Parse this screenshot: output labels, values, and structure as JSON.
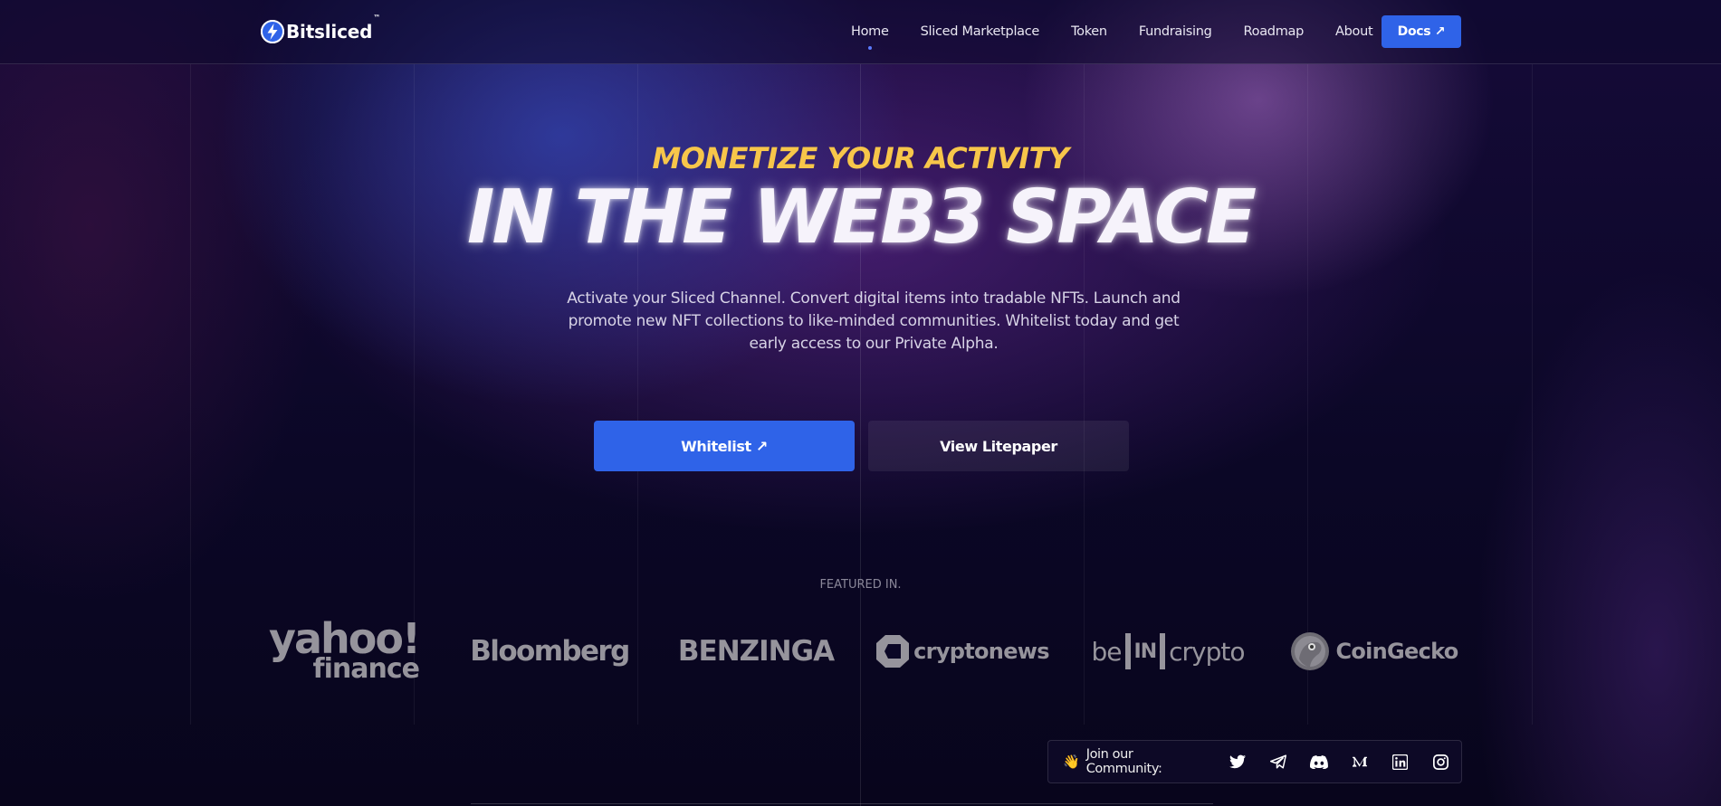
{
  "header": {
    "brand": "Bitsliced",
    "brand_tm": "™",
    "nav": [
      {
        "label": "Home",
        "active": true
      },
      {
        "label": "Sliced Marketplace",
        "active": false
      },
      {
        "label": "Token",
        "active": false
      },
      {
        "label": "Fundraising",
        "active": false
      },
      {
        "label": "Roadmap",
        "active": false
      },
      {
        "label": "About",
        "active": false
      }
    ],
    "docs_button": "Docs ↗"
  },
  "hero": {
    "subtitle": "MONETIZE YOUR ACTIVITY",
    "title": "IN THE WEB3 SPACE",
    "description": "Activate your Sliced Channel. Convert digital items into tradable NFTs. Launch and promote new NFT collections to like-minded communities. Whitelist today and get early access to our Private Alpha.",
    "primary_button": "Whitelist ↗",
    "secondary_button": "View Litepaper"
  },
  "featured": {
    "label": "FEATURED IN.",
    "logos": {
      "yahoo_top": "yahoo!",
      "yahoo_bottom": "finance",
      "bloomberg": "Bloomberg",
      "benzinga": "BENZINGA",
      "cryptonews": "cryptonews",
      "bein_be": "be",
      "bein_in": "IN",
      "bein_crypto": "crypto",
      "coingecko": "CoinGecko"
    }
  },
  "community": {
    "label": "Join our Community:",
    "icons": [
      "twitter-icon",
      "telegram-icon",
      "discord-icon",
      "medium-icon",
      "linkedin-icon",
      "instagram-icon"
    ]
  },
  "colors": {
    "accent_blue": "#2f63e8",
    "headline_yellow": "#f7c64a",
    "background": "#0a0622"
  }
}
